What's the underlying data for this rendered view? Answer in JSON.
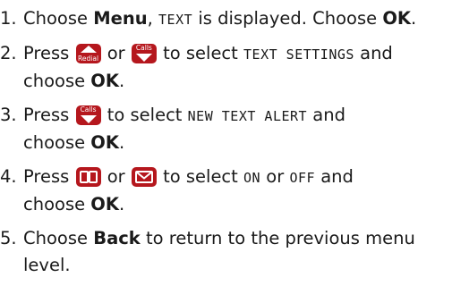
{
  "steps": [
    {
      "num": "1.",
      "parts": {
        "t1": "Choose ",
        "b1": "Menu",
        "t2": ", ",
        "lcd1": "TEXT",
        "t3": " is displayed. Choose ",
        "b2": "OK",
        "t4": "."
      }
    },
    {
      "num": "2.",
      "parts": {
        "t1": "Press ",
        "t2": " or ",
        "t3": " to select ",
        "lcd1": "TEXT SETTINGS",
        "t4": " and",
        "t5": "choose ",
        "b1": "OK",
        "t6": "."
      }
    },
    {
      "num": "3.",
      "parts": {
        "t1": "Press ",
        "t2": " to select ",
        "lcd1": "NEW TEXT ALERT",
        "t3": " and",
        "t4": "choose ",
        "b1": "OK",
        "t5": "."
      }
    },
    {
      "num": "4.",
      "parts": {
        "t1": "Press ",
        "t2": " or ",
        "t3": " to select ",
        "lcd1": "ON",
        "t4": " or ",
        "lcd2": "OFF",
        "t5": " and",
        "t6": "choose ",
        "b1": "OK",
        "t7": "."
      }
    },
    {
      "num": "5.",
      "parts": {
        "t1": "Choose ",
        "b1": "Back",
        "t2": " to return to the previous menu",
        "t3": "level."
      }
    }
  ],
  "keys": {
    "redial_label": "Redial",
    "calls_label": "Calls",
    "redial_icon": "up-arrow-redial-key-icon",
    "calls_icon": "down-arrow-calls-key-icon",
    "book_icon": "phonebook-key-icon",
    "envelope_icon": "message-envelope-key-icon",
    "key_color": "#b5171d"
  }
}
